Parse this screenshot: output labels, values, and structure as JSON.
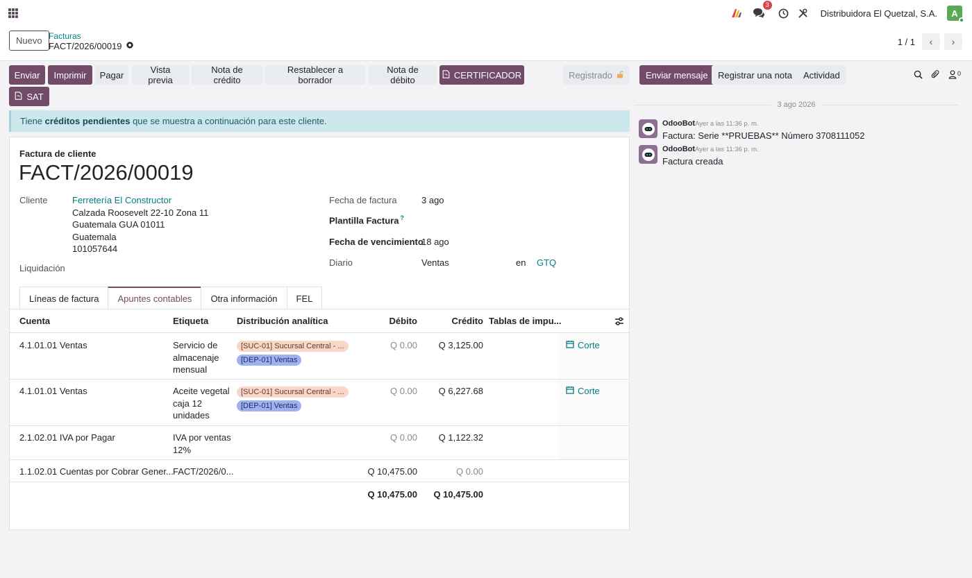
{
  "navbar": {
    "notification_count": "3",
    "company": "Distribuidora El Quetzal, S.A.",
    "user_initial": "A",
    "accent": "#714b67"
  },
  "control_panel": {
    "new_label": "Nuevo",
    "breadcrumb_parent": "Facturas",
    "breadcrumb_current": "FACT/2026/00019",
    "pager": "1 / 1"
  },
  "actions": {
    "enviar": "Enviar",
    "imprimir": "Imprimir",
    "pagar": "Pagar",
    "vista_previa": "Vista previa",
    "nota_credito": "Nota de crédito",
    "restablecer": "Restablecer a borrador",
    "nota_debito": "Nota de débito",
    "certificador": "CERTIFICADOR",
    "sat": "SAT",
    "status": "Registrado"
  },
  "alert": {
    "prefix": "Tiene ",
    "bold": "créditos pendientes",
    "suffix": " que se muestra a continuación para este cliente."
  },
  "invoice": {
    "doc_type": "Factura de cliente",
    "number": "FACT/2026/00019",
    "customer_label": "Cliente",
    "customer_name": "Ferretería El Constructor",
    "address": [
      "Calzada Roosevelt 22-10 Zona 11",
      "Guatemala GUA 01011",
      "Guatemala",
      "101057644"
    ],
    "liquidacion_label": "Liquidación",
    "fecha_factura_label": "Fecha de factura",
    "fecha_factura": "3 ago",
    "plantilla_label": "Plantilla Factura",
    "plantilla_help": "?",
    "vencimiento_label": "Fecha de vencimiento",
    "vencimiento": "18 ago",
    "diario_label": "Diario",
    "diario": "Ventas",
    "en_label": "en",
    "currency": "GTQ"
  },
  "tabs": [
    "Líneas de factura",
    "Apuntes contables",
    "Otra información",
    "FEL"
  ],
  "table": {
    "headers": {
      "cuenta": "Cuenta",
      "etiqueta": "Etiqueta",
      "analitica": "Distribución analítica",
      "debito": "Débito",
      "credito": "Crédito",
      "impuestos": "Tablas de impu..."
    },
    "rows": [
      {
        "cuenta": "4.1.01.01 Ventas",
        "etiqueta": [
          "Servicio de",
          "almacenaje",
          "mensual"
        ],
        "tags": [
          "[SUC-01] Sucursal Central - ...",
          "[DEP-01] Ventas"
        ],
        "debito": "Q 0.00",
        "credito": "Q 3,125.00",
        "impuesto": "Corte"
      },
      {
        "cuenta": "4.1.01.01 Ventas",
        "etiqueta": [
          "Aceite vegetal",
          "caja 12",
          "unidades"
        ],
        "tags": [
          "[SUC-01] Sucursal Central - ...",
          "[DEP-01] Ventas"
        ],
        "debito": "Q 0.00",
        "credito": "Q 6,227.68",
        "impuesto": "Corte"
      },
      {
        "cuenta": "2.1.02.01 IVA por Pagar",
        "etiqueta": [
          "IVA por ventas",
          "12%"
        ],
        "debito": "Q 0.00",
        "credito": "Q 1,122.32"
      },
      {
        "cuenta": "1.1.02.01 Cuentas por Cobrar Gener...",
        "etiqueta": [
          "FACT/2026/0..."
        ],
        "debito": "Q 10,475.00",
        "credito": "Q 0.00"
      }
    ],
    "total_debito": "Q 10,475.00",
    "total_credito": "Q 10,475.00"
  },
  "chatter": {
    "send_message": "Enviar mensaje",
    "log_note": "Registrar una nota",
    "activity": "Actividad",
    "follower_count": "0",
    "date_separator": "3 ago 2026",
    "messages": [
      {
        "author": "OdooBot",
        "time": "Ayer a las 11:36 p. m.",
        "body": "Factura: Serie **PRUEBAS** Número 3708111052"
      },
      {
        "author": "OdooBot",
        "time": "Ayer a las 11:36 p. m.",
        "body": "Factura creada"
      }
    ]
  }
}
